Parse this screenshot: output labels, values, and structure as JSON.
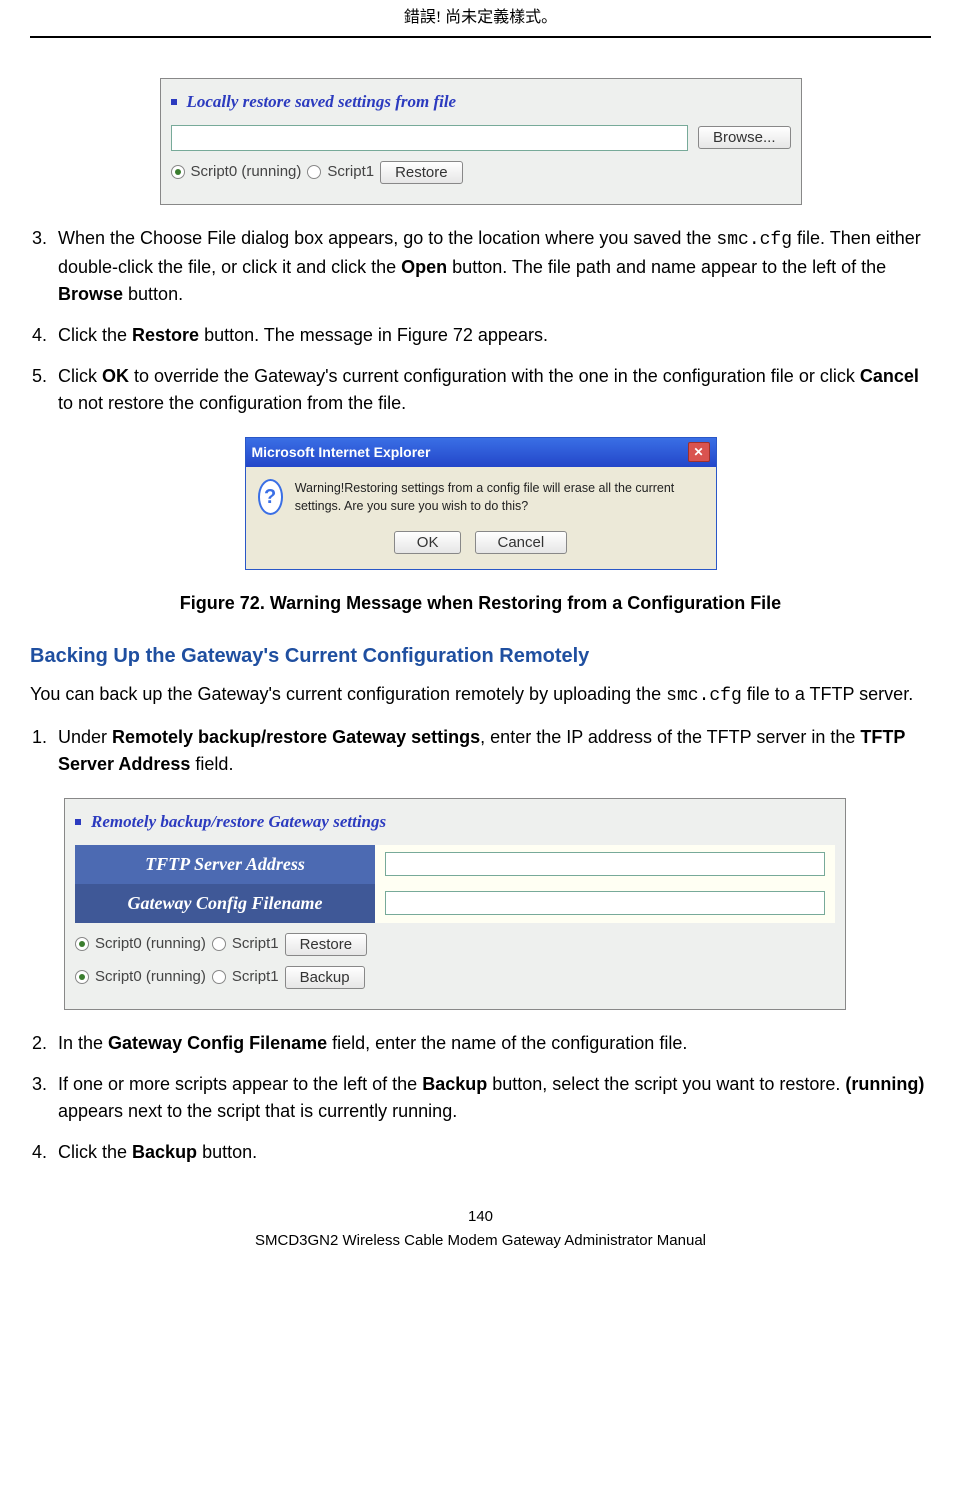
{
  "header": "錯誤! 尚未定義樣式。",
  "panel_a": {
    "title": "Locally restore saved settings from file",
    "browse": "Browse...",
    "script0": "Script0 (running)",
    "script1": "Script1",
    "restore": "Restore"
  },
  "steps_a": {
    "s3_a": "When the Choose File dialog box appears, go to the location where you saved the ",
    "s3_code": "smc.cfg",
    "s3_b": " file. Then either double-click the file, or click it and click the ",
    "s3_bold1": "Open",
    "s3_c": " button. The file path and name appear to the left of the ",
    "s3_bold2": "Browse",
    "s3_d": " button.",
    "s4_a": "Click the ",
    "s4_bold": "Restore",
    "s4_b": " button. The message in Figure 72 appears.",
    "s5_a": "Click ",
    "s5_bold1": "OK",
    "s5_b": " to override the Gateway's current configuration with the one in the configuration file or click ",
    "s5_bold2": "Cancel",
    "s5_c": " to not restore the configuration from the file."
  },
  "popup": {
    "title": "Microsoft Internet Explorer",
    "msg": "Warning!Restoring settings from a config file will erase all the current settings. Are you sure you wish to do this?",
    "ok": "OK",
    "cancel": "Cancel"
  },
  "fig72_caption": "Figure 72. Warning Message when Restoring from a Configuration File",
  "section2_title": "Backing Up the Gateway's Current Configuration Remotely",
  "section2_intro_a": "You can back up the Gateway's current configuration remotely by uploading the ",
  "section2_intro_code": "smc.cfg",
  "section2_intro_b": " file to a TFTP server.",
  "steps_b": {
    "s1_a": "Under ",
    "s1_bold1": "Remotely backup/restore Gateway settings",
    "s1_b": ", enter the IP address of the TFTP server in the ",
    "s1_bold2": "TFTP Server Address",
    "s1_c": " field."
  },
  "panel_c": {
    "title": "Remotely backup/restore Gateway settings",
    "row1_label": "TFTP Server Address",
    "row2_label": "Gateway Config Filename",
    "script0": "Script0 (running)",
    "script1": "Script1",
    "restore": "Restore",
    "backup": "Backup"
  },
  "steps_c": {
    "s2_a": "In the ",
    "s2_bold": "Gateway Config Filename",
    "s2_b": " field, enter the name of the configuration file.",
    "s3_a": "If one or more scripts appear to the left of the ",
    "s3_bold1": "Backup",
    "s3_b": " button, select the script you want to restore. ",
    "s3_bold2": "(running)",
    "s3_c": " appears next to the script that is currently running.",
    "s4_a": "Click the ",
    "s4_bold": "Backup",
    "s4_b": " button."
  },
  "footer": {
    "page": "140",
    "doc": "SMCD3GN2 Wireless Cable Modem Gateway Administrator Manual"
  }
}
